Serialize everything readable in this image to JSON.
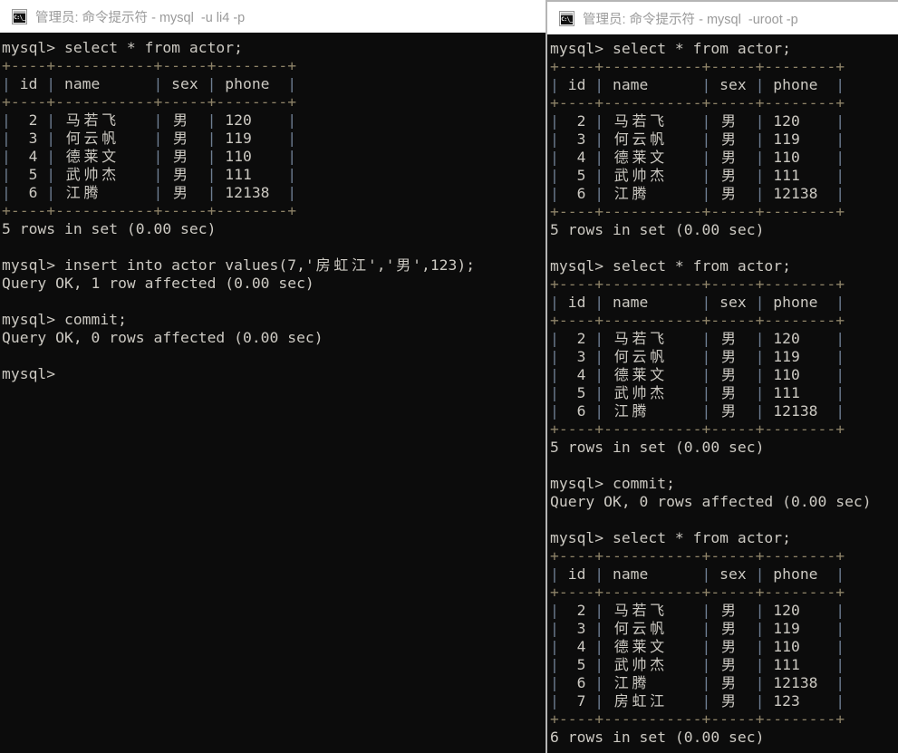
{
  "app": {
    "name": "命令提示符",
    "program": "mysql",
    "background_color": "#0c0c0c",
    "foreground_color": "#cccccc",
    "titlebar_color": "#ffffff",
    "titlebar_text_color": "#9a9a9a"
  },
  "windows": {
    "left": {
      "title": "管理员: 命令提示符 - mysql  -u li4 -p",
      "user": "li4",
      "prompt": "mysql>",
      "lines": [
        "mysql> select * from actor;",
        "+----+-----------+-----+--------+",
        "| id | name      | sex | phone  |",
        "+----+-----------+-----+--------+",
        "|  2 | 马若飞    | 男  | 120    |",
        "|  3 | 何云帆    | 男  | 119    |",
        "|  4 | 德莱文    | 男  | 110    |",
        "|  5 | 武帅杰    | 男  | 111    |",
        "|  6 | 江腾      | 男  | 12138  |",
        "+----+-----------+-----+--------+",
        "5 rows in set (0.00 sec)",
        "",
        "mysql> insert into actor values(7,'房虹江','男',123);",
        "Query OK, 1 row affected (0.00 sec)",
        "",
        "mysql> commit;",
        "Query OK, 0 rows affected (0.00 sec)",
        "",
        "mysql>"
      ]
    },
    "right": {
      "title": "管理员: 命令提示符 - mysql  -uroot -p",
      "user": "root",
      "prompt": "mysql>",
      "lines": [
        "mysql> select * from actor;",
        "+----+-----------+-----+--------+",
        "| id | name      | sex | phone  |",
        "+----+-----------+-----+--------+",
        "|  2 | 马若飞    | 男  | 120    |",
        "|  3 | 何云帆    | 男  | 119    |",
        "|  4 | 德莱文    | 男  | 110    |",
        "|  5 | 武帅杰    | 男  | 111    |",
        "|  6 | 江腾      | 男  | 12138  |",
        "+----+-----------+-----+--------+",
        "5 rows in set (0.00 sec)",
        "",
        "mysql> select * from actor;",
        "+----+-----------+-----+--------+",
        "| id | name      | sex | phone  |",
        "+----+-----------+-----+--------+",
        "|  2 | 马若飞    | 男  | 120    |",
        "|  3 | 何云帆    | 男  | 119    |",
        "|  4 | 德莱文    | 男  | 110    |",
        "|  5 | 武帅杰    | 男  | 111    |",
        "|  6 | 江腾      | 男  | 12138  |",
        "+----+-----------+-----+--------+",
        "5 rows in set (0.00 sec)",
        "",
        "mysql> commit;",
        "Query OK, 0 rows affected (0.00 sec)",
        "",
        "mysql> select * from actor;",
        "+----+-----------+-----+--------+",
        "| id | name      | sex | phone  |",
        "+----+-----------+-----+--------+",
        "|  2 | 马若飞    | 男  | 120    |",
        "|  3 | 何云帆    | 男  | 119    |",
        "|  4 | 德莱文    | 男  | 110    |",
        "|  5 | 武帅杰    | 男  | 111    |",
        "|  6 | 江腾      | 男  | 12138  |",
        "|  7 | 房虹江    | 男  | 123    |",
        "+----+-----------+-----+--------+",
        "6 rows in set (0.00 sec)"
      ]
    }
  },
  "table": {
    "name": "actor",
    "columns": [
      "id",
      "name",
      "sex",
      "phone"
    ],
    "rows_before_insert": [
      {
        "id": "2",
        "name": "马若飞",
        "sex": "男",
        "phone": "120"
      },
      {
        "id": "3",
        "name": "何云帆",
        "sex": "男",
        "phone": "119"
      },
      {
        "id": "4",
        "name": "德莱文",
        "sex": "男",
        "phone": "110"
      },
      {
        "id": "5",
        "name": "武帅杰",
        "sex": "男",
        "phone": "111"
      },
      {
        "id": "6",
        "name": "江腾",
        "sex": "男",
        "phone": "12138"
      }
    ],
    "rows_after_commit": [
      {
        "id": "2",
        "name": "马若飞",
        "sex": "男",
        "phone": "120"
      },
      {
        "id": "3",
        "name": "何云帆",
        "sex": "男",
        "phone": "119"
      },
      {
        "id": "4",
        "name": "德莱文",
        "sex": "男",
        "phone": "110"
      },
      {
        "id": "5",
        "name": "武帅杰",
        "sex": "男",
        "phone": "111"
      },
      {
        "id": "6",
        "name": "江腾",
        "sex": "男",
        "phone": "12138"
      },
      {
        "id": "7",
        "name": "房虹江",
        "sex": "男",
        "phone": "123"
      }
    ],
    "row_count_before": "5 rows in set (0.00 sec)",
    "row_count_after": "6 rows in set (0.00 sec)"
  },
  "statements": {
    "select": "select * from actor;",
    "insert": "insert into actor values(7,'房虹江','男',123);",
    "commit": "commit;",
    "insert_result": "Query OK, 1 row affected (0.00 sec)",
    "commit_result": "Query OK, 0 rows affected (0.00 sec)"
  },
  "icons": {
    "cmd_prompt": "cmd-prompt-icon",
    "cmd_prompt_glyph": "C:\\_"
  }
}
